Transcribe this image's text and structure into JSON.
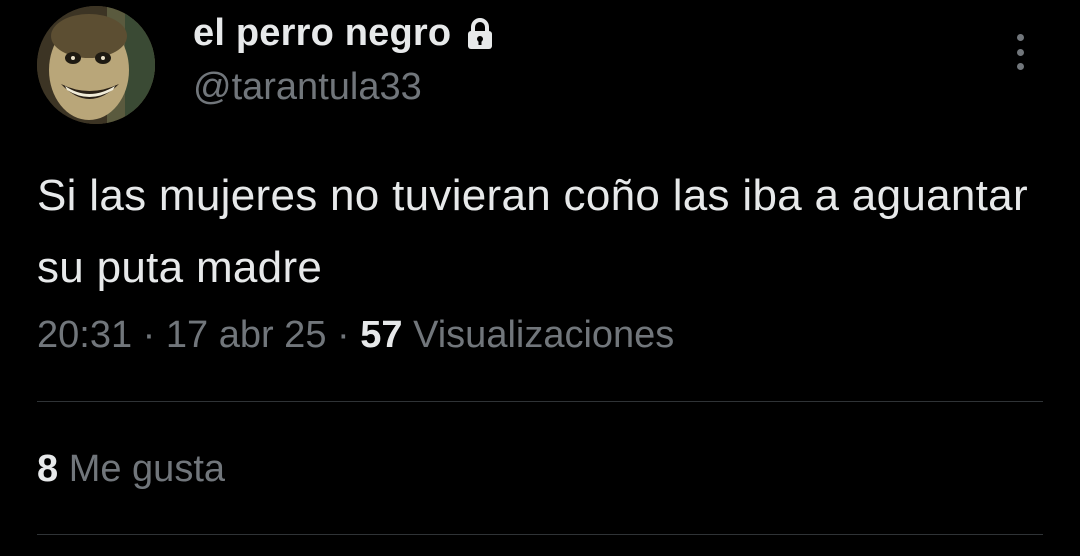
{
  "tweet": {
    "author": {
      "display_name": "el perro negro",
      "handle": "@tarantula33",
      "protected_icon": "lock-icon"
    },
    "more_icon": "more-vertical-icon",
    "text": "Si las mujeres no tuvieran coño las iba a aguantar su puta madre",
    "meta": {
      "time": "20:31",
      "separator": "·",
      "date": "17 abr 25",
      "views_count": "57",
      "views_label": "Visualizaciones"
    },
    "likes": {
      "count": "8",
      "label": "Me gusta"
    }
  },
  "colors": {
    "background": "#000000",
    "text_primary": "#e7e9ea",
    "text_secondary": "#71767b",
    "divider": "#2f3336"
  }
}
